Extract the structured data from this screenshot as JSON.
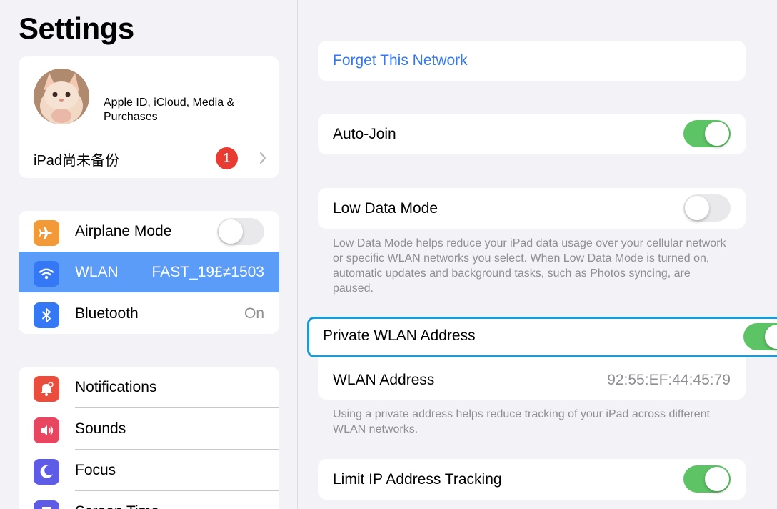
{
  "sidebar": {
    "title": "Settings",
    "profile": {
      "apple_id_text": "Apple ID, iCloud, Media & Purchases",
      "backup_label": "iPad尚未备份",
      "badge_count": "1"
    },
    "connectivity": [
      {
        "label": "Airplane Mode",
        "icon": "airplane-icon",
        "value": "",
        "toggle": "off"
      },
      {
        "label": "WLAN",
        "icon": "wifi-icon",
        "value": "FAST_19£≠1503",
        "selected": true
      },
      {
        "label": "Bluetooth",
        "icon": "bluetooth-icon",
        "value": "On"
      }
    ],
    "general": [
      {
        "label": "Notifications",
        "icon": "bell-icon"
      },
      {
        "label": "Sounds",
        "icon": "speaker-icon"
      },
      {
        "label": "Focus",
        "icon": "moon-icon"
      },
      {
        "label": "Screen Time",
        "icon": "hourglass-icon"
      }
    ]
  },
  "detail": {
    "forget_label": "Forget This Network",
    "auto_join": {
      "label": "Auto-Join",
      "state": "on"
    },
    "low_data": {
      "label": "Low Data Mode",
      "state": "off",
      "footnote": "Low Data Mode helps reduce your iPad data usage over your cellular network or specific WLAN networks you select. When Low Data Mode is turned on, automatic updates and background tasks, such as Photos syncing, are paused."
    },
    "private_address": {
      "label": "Private WLAN Address",
      "state": "on"
    },
    "wlan_address": {
      "label": "WLAN Address",
      "value": "92:55:EF:44:45:79"
    },
    "private_footnote": "Using a private address helps reduce tracking of your iPad across different WLAN networks.",
    "limit_ip": {
      "label": "Limit IP Address Tracking",
      "state": "on"
    }
  },
  "colors": {
    "accent": "#3478f6",
    "selected_row": "#5a9cf8",
    "toggle_on": "#5dc466",
    "toggle_off": "#e9e9eb",
    "badge": "#ea3b33",
    "highlight_border": "#1a9bd7",
    "airplane_icon_bg": "#f29a38",
    "wifi_icon_bg": "#3478f6",
    "bluetooth_icon_bg": "#3478f6",
    "notifications_icon_bg": "#eb4d3d",
    "sounds_icon_bg": "#e84560",
    "focus_icon_bg": "#5e5ce6",
    "screen_time_icon_bg": "#5e5ce6"
  }
}
